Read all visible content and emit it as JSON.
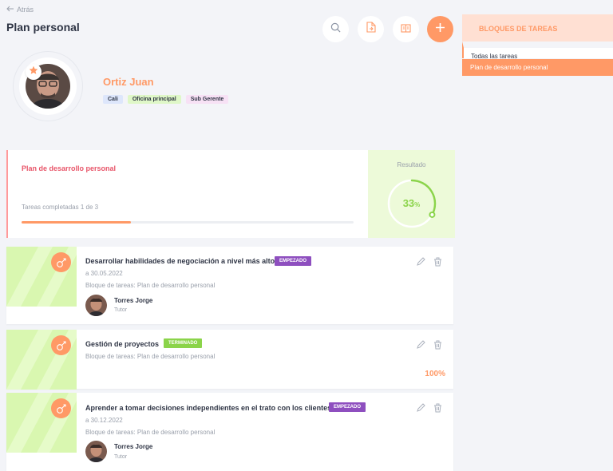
{
  "nav": {
    "back_label": "Atrás"
  },
  "page": {
    "title": "Plan personal"
  },
  "toolbar": {
    "search_icon": "search-icon",
    "export_icon": "file-export-icon",
    "view_icon": "view-columns-icon",
    "add_icon": "plus-icon"
  },
  "profile": {
    "name": "Ortiz Juan",
    "tags": [
      "Cali",
      "Oficina principal",
      "Sub Gerente"
    ],
    "tag_colors": [
      "#dde6fb",
      "#dff7c8",
      "#f7e1f5"
    ]
  },
  "summary": {
    "title": "Plan de desarrollo personal",
    "completed_text": "Tareas completadas 1 de 3",
    "progress": 0.33,
    "result_label": "Resultado",
    "result_value": "33",
    "result_unit": "%"
  },
  "tasks": [
    {
      "title": "Desarrollar habilidades de negociación a nivel más alto",
      "status": "EMPEZADO",
      "status_color": "#8e4fbf",
      "due": "a 30.05.2022",
      "block": "Bloque de tareas: Plan de desarrollo personal",
      "person": "Torres Jorge",
      "role": "Tutor"
    },
    {
      "title": "Gestión de proyectos",
      "status": "TERMINADO",
      "status_color": "#8bd44a",
      "block": "Bloque de tareas: Plan de desarrollo personal",
      "percent": "100%"
    },
    {
      "title": "Aprender a tomar decisiones independientes en el trato con los clientes",
      "status": "EMPEZADO",
      "status_color": "#8e4fbf",
      "due": "a 30.12.2022",
      "block": "Bloque de tareas: Plan de desarrollo personal",
      "person": "Torres Jorge",
      "role": "Tutor"
    }
  ],
  "task_blocks": {
    "header": "BLOQUES DE TAREAS",
    "items": [
      "Todas las tareas",
      "Plan de desarrollo personal"
    ],
    "active_index": 1
  },
  "colors": {
    "accent": "#ff9966",
    "green": "#8bd44a",
    "purple": "#8e4fbf"
  }
}
